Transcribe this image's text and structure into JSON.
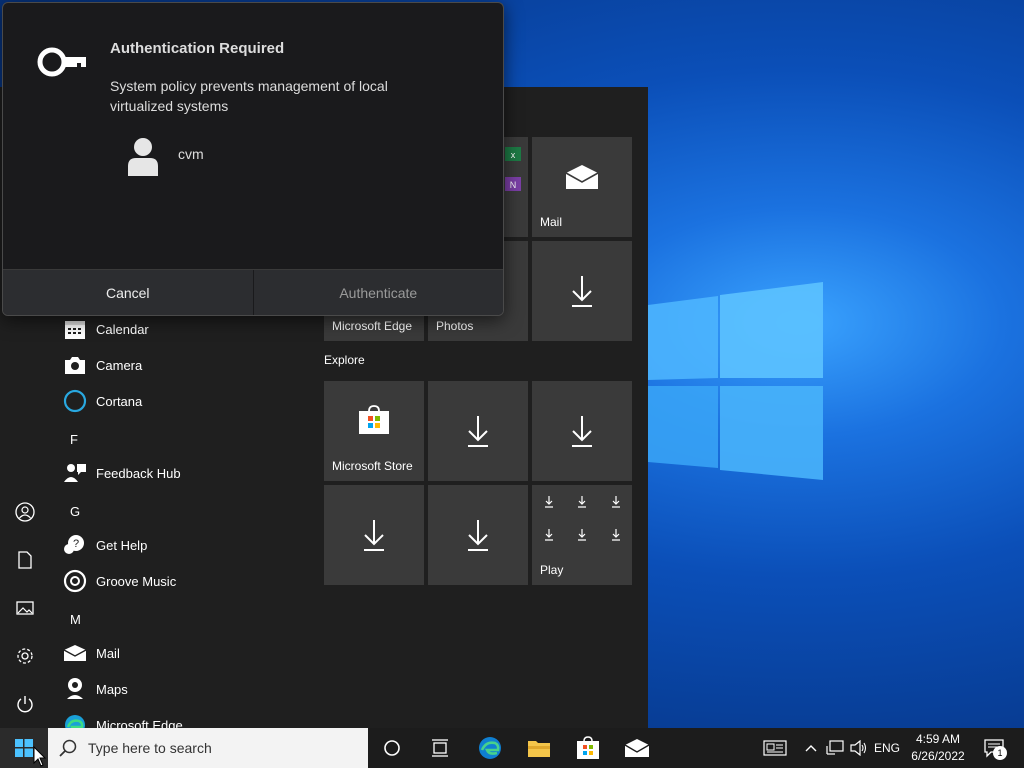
{
  "auth_dialog": {
    "title": "Authentication Required",
    "message": "System policy prevents management of local virtualized systems",
    "username": "cvm",
    "cancel_label": "Cancel",
    "authenticate_label": "Authenticate"
  },
  "start_menu": {
    "apps": [
      {
        "label": "Calendar",
        "icon": "calendar-icon"
      },
      {
        "label": "Camera",
        "icon": "camera-icon"
      },
      {
        "label": "Cortana",
        "icon": "cortana-icon"
      },
      {
        "letter": "F"
      },
      {
        "label": "Feedback Hub",
        "icon": "feedback-hub-icon"
      },
      {
        "letter": "G"
      },
      {
        "label": "Get Help",
        "icon": "get-help-icon"
      },
      {
        "label": "Groove Music",
        "icon": "groove-music-icon"
      },
      {
        "letter": "M"
      },
      {
        "label": "Mail",
        "icon": "mail-icon"
      },
      {
        "label": "Maps",
        "icon": "maps-icon"
      },
      {
        "label": "Microsoft Edge",
        "icon": "edge-icon"
      }
    ],
    "tiles": {
      "mail": "Mail",
      "edge": "Microsoft Edge",
      "photos": "Photos",
      "explore_group": "Explore",
      "store": "Microsoft Store",
      "play": "Play"
    }
  },
  "taskbar": {
    "search_placeholder": "Type here to search",
    "language": "ENG",
    "time": "4:59 AM",
    "date": "6/26/2022",
    "notification_count": "1"
  },
  "colors": {
    "accent": "#0078d7",
    "tile_bg": "#3a3a3a",
    "start_bg": "#1f1f1f",
    "dialog_bg": "#1a1a1c"
  }
}
